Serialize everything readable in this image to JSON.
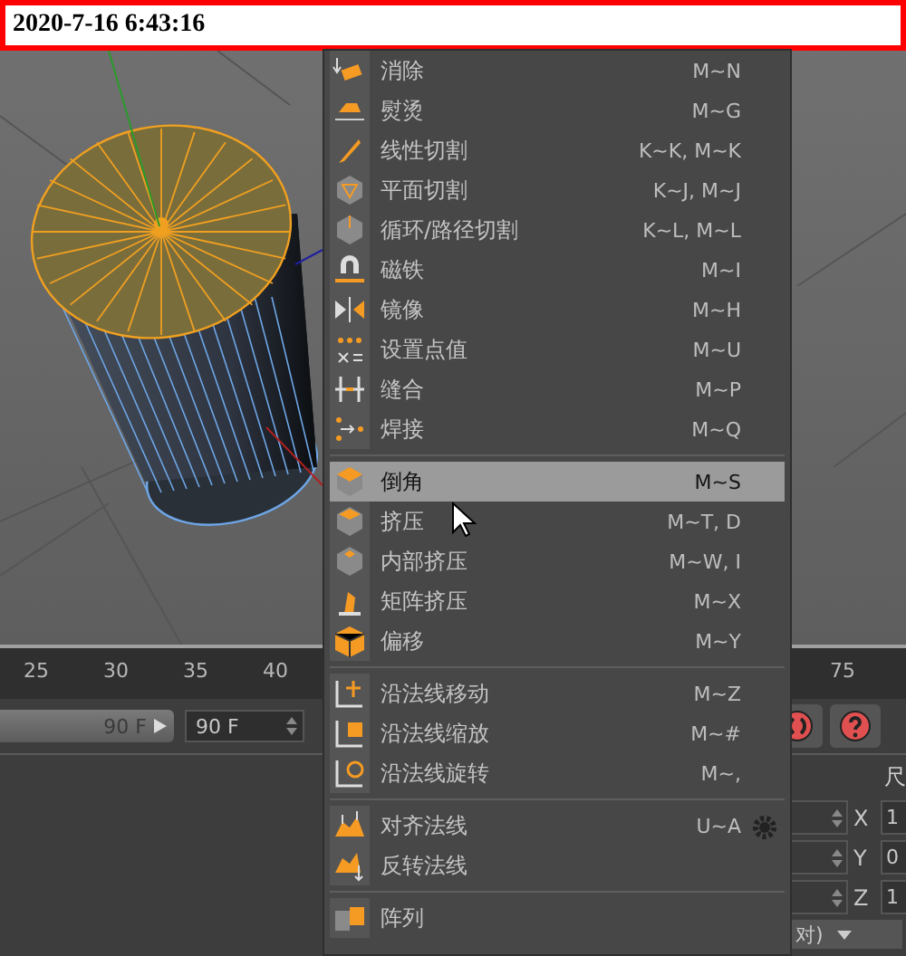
{
  "timestamp": "2020-7-16 6:43:16",
  "timeline": {
    "ticks": [
      "25",
      "30",
      "35",
      "40",
      "75"
    ]
  },
  "playback": {
    "range": {
      "value": "90 F",
      "level": 1
    },
    "frame_field": "90 F"
  },
  "attributes": {
    "tab_label": "尺",
    "coords": [
      {
        "axis": "X",
        "value": "1"
      },
      {
        "axis": "Y",
        "value": "0"
      },
      {
        "axis": "Z",
        "value": "1"
      }
    ],
    "dropdown": "对)"
  },
  "menu": {
    "groups": [
      [
        {
          "label": "消除",
          "shortcut": "M~N",
          "selected": false,
          "options": false
        },
        {
          "label": "熨烫",
          "shortcut": "M~G",
          "selected": false,
          "options": false
        },
        {
          "label": "线性切割",
          "shortcut": "K~K, M~K",
          "selected": false,
          "options": false
        },
        {
          "label": "平面切割",
          "shortcut": "K~J, M~J",
          "selected": false,
          "options": false
        },
        {
          "label": "循环/路径切割",
          "shortcut": "K~L, M~L",
          "selected": false,
          "options": false
        },
        {
          "label": "磁铁",
          "shortcut": "M~I",
          "selected": false,
          "options": false
        },
        {
          "label": "镜像",
          "shortcut": "M~H",
          "selected": false,
          "options": false
        },
        {
          "label": "设置点值",
          "shortcut": "M~U",
          "selected": false,
          "options": false
        },
        {
          "label": "缝合",
          "shortcut": "M~P",
          "selected": false,
          "options": false
        },
        {
          "label": "焊接",
          "shortcut": "M~Q",
          "selected": false,
          "options": false
        }
      ],
      [
        {
          "label": "倒角",
          "shortcut": "M~S",
          "selected": true,
          "options": false
        },
        {
          "label": "挤压",
          "shortcut": "M~T, D",
          "selected": false,
          "options": false
        },
        {
          "label": "内部挤压",
          "shortcut": "M~W, I",
          "selected": false,
          "options": false
        },
        {
          "label": "矩阵挤压",
          "shortcut": "M~X",
          "selected": false,
          "options": false
        },
        {
          "label": "偏移",
          "shortcut": "M~Y",
          "selected": false,
          "options": false
        }
      ],
      [
        {
          "label": "沿法线移动",
          "shortcut": "M~Z",
          "selected": false,
          "options": false
        },
        {
          "label": "沿法线缩放",
          "shortcut": "M~#",
          "selected": false,
          "options": false
        },
        {
          "label": "沿法线旋转",
          "shortcut": "M~,",
          "selected": false,
          "options": false
        }
      ],
      [
        {
          "label": "对齐法线",
          "shortcut": "U~A",
          "selected": false,
          "options": true
        },
        {
          "label": "反转法线",
          "selected": false,
          "options": false
        }
      ],
      [
        {
          "label": "阵列",
          "selected": false,
          "options": false
        }
      ]
    ]
  }
}
